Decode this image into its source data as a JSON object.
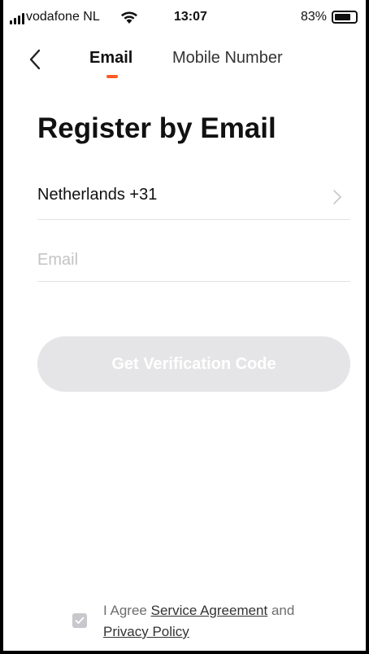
{
  "status_bar": {
    "carrier": "vodafone NL",
    "time": "13:07",
    "battery": "83%",
    "signal_icon": "signal-bars-icon",
    "wifi_icon": "wifi-icon",
    "battery_icon": "battery-icon"
  },
  "nav": {
    "back_icon": "chevron-left-icon",
    "tabs": [
      {
        "label": "Email",
        "active": true
      },
      {
        "label": "Mobile Number",
        "active": false
      }
    ],
    "accent_color": "#ff5a1f"
  },
  "main": {
    "title": "Register by Email",
    "country": {
      "label": "Netherlands +31",
      "icon": "chevron-right-icon"
    },
    "email": {
      "placeholder": "Email",
      "value": ""
    },
    "verify_button": {
      "label": "Get Verification Code",
      "enabled": false,
      "disabled_color": "#e5e5e7"
    }
  },
  "agreement": {
    "checked": true,
    "prefix": "I Agree ",
    "service_link": "Service Agreement",
    "middle": " and ",
    "privacy_link": "Privacy Policy"
  }
}
